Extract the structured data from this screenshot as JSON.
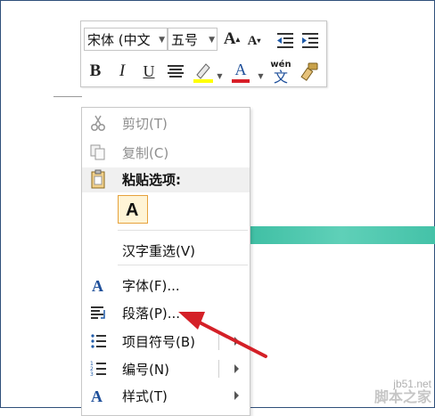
{
  "mini_toolbar": {
    "font_name": "宋体 (中⽂",
    "font_size": "五号",
    "grow_font": "A",
    "shrink_font": "A",
    "bold": "B",
    "italic": "I",
    "underline": "U",
    "font_color": "A",
    "highlight_color": "#ffff00",
    "font_color_value": "#d81e28",
    "phonetic_top": "wén",
    "phonetic_bottom": "文"
  },
  "menu": {
    "cut": "剪切(T)",
    "copy": "复制(C)",
    "paste_options": "粘贴选项:",
    "paste_keep_text": "A",
    "reconvert": "汉字重选(V)",
    "font": "字体(F)...",
    "paragraph": "段落(P)...",
    "bullets": "项目符号(B)",
    "numbering": "编号(N)",
    "styles": "样式(T)"
  },
  "watermark": {
    "site": "jb51.net",
    "name": "脚本之家"
  },
  "colors": {
    "arrow": "#d42027",
    "accent_band": "#3fbfa4"
  }
}
